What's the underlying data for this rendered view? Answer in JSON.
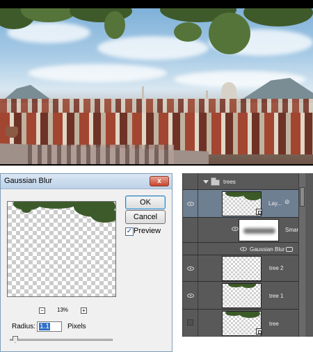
{
  "dialog": {
    "title": "Gaussian Blur",
    "close_label": "x",
    "ok_label": "OK",
    "cancel_label": "Cancel",
    "preview_label": "Preview",
    "preview_checked": true,
    "zoom_out_label": "−",
    "zoom_in_label": "+",
    "zoom_value": "13%",
    "radius_label": "Radius:",
    "radius_value": "1.1",
    "radius_unit": "Pixels",
    "slider_level_fraction": 0.03
  },
  "layers": {
    "group_name": "trees",
    "items": [
      {
        "name": "Lay...",
        "type": "smart-object",
        "selected": true,
        "visible": true
      },
      {
        "name": "Smar",
        "type": "smart-filters-mask"
      },
      {
        "name": "Gaussian Blur",
        "type": "filter-effect",
        "visible": true
      },
      {
        "name": "tree 2",
        "type": "layer",
        "visible": true
      },
      {
        "name": "tree 1",
        "type": "layer",
        "visible": true
      },
      {
        "name": "tree",
        "type": "smart-object",
        "visible": false
      }
    ]
  },
  "colors": {
    "panel_bg": "#595959",
    "selected_row": "#6f7f92",
    "dialog_bg": "#f0f0f0"
  }
}
